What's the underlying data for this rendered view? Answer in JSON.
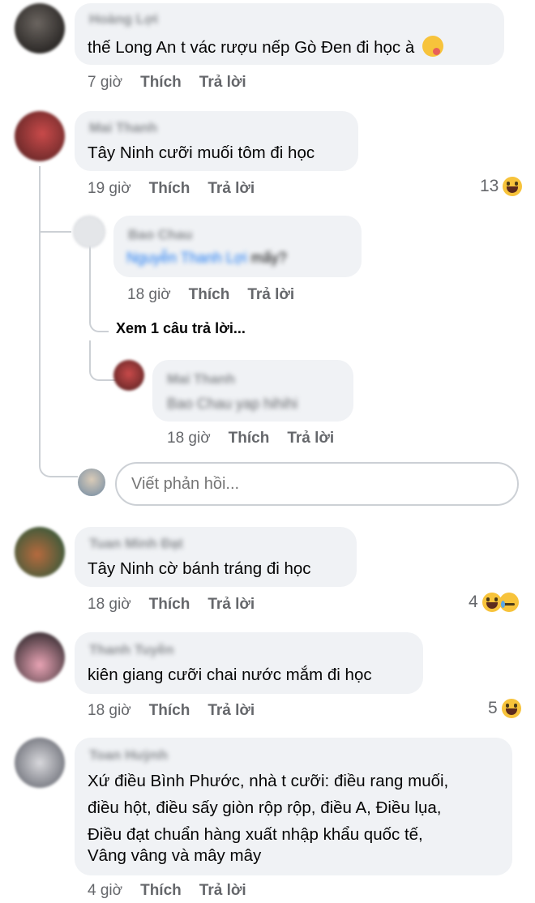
{
  "comments": [
    {
      "name": "Hoàng Lợi",
      "text": "thế Long An t vác rượu nếp Gò Đen đi học à",
      "time": "7 giờ",
      "like": "Thích",
      "reply": "Trả lời",
      "emoji": "yum-face-icon"
    },
    {
      "name": "Mai Thanh",
      "text": "Tây Ninh cưỡi muối tôm đi học",
      "time": "19 giờ",
      "like": "Thích",
      "reply": "Trả lời",
      "reaction_count": "13"
    },
    {
      "name": "Tuan Minh Đạt",
      "text": "Tây Ninh cờ bánh tráng đi học",
      "time": "18 giờ",
      "like": "Thích",
      "reply": "Trả lời",
      "reaction_count": "4"
    },
    {
      "name": "Thanh Tuyền",
      "text": "kiên giang cưỡi chai nước mắm đi học",
      "time": "18 giờ",
      "like": "Thích",
      "reply": "Trả lời",
      "reaction_count": "5"
    },
    {
      "name": "Toan Huỳnh",
      "lines": [
        "Xứ điều Bình Phước, nhà t cưỡi: điều rang muối,",
        "điều hột, điều sấy giòn rộp rộp, điều A, Điều lụa,",
        "Điều đạt chuẩn hàng xuất nhập khẩu quốc tế,",
        "Vâng vâng và mây mây"
      ],
      "time": "4 giờ",
      "like": "Thích",
      "reply": "Trả lời"
    }
  ],
  "replies": [
    {
      "name": "Bao Chau",
      "mention": "Nguyễn Thanh Lợi",
      "text": "mấy?",
      "time": "18 giờ",
      "like": "Thích",
      "reply": "Trả lời"
    },
    {
      "name": "Mai Thanh",
      "text": "Bao Chau yap hihihi",
      "time": "18 giờ",
      "like": "Thích",
      "reply": "Trả lời"
    }
  ],
  "view_more_replies": "Xem 1 câu trả lời...",
  "reply_input": {
    "placeholder": "Viết phản hồi..."
  },
  "colors": {
    "bubble": "#f0f2f5",
    "meta": "#65676b",
    "mention": "#1877f2",
    "emoji": "#f7c33b"
  }
}
